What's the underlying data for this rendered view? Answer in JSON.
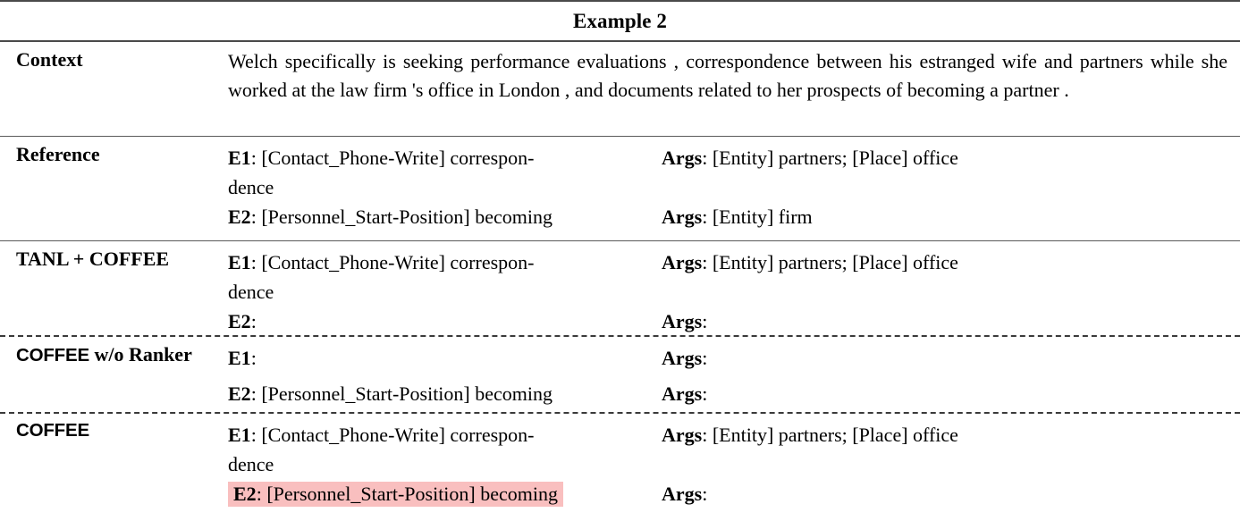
{
  "title": "Example 2",
  "highlight_color": "#f9bfbf",
  "rule_color": "#4a4a4a",
  "labels": {
    "context": "Context",
    "reference": "Reference",
    "tanl_coffee": "TANL + COFFEE",
    "coffee_wo_ranker_sans": "COFFEE",
    "coffee_wo_ranker_serif": " w/o Ranker",
    "coffee": "COFFEE"
  },
  "context": {
    "text": "Welch specifically is seeking performance evaluations , correspondence between his estranged wife and partners while she worked at the law firm 's office in London , and documents related to her prospects of becoming a partner ."
  },
  "tags": {
    "e1": "E1",
    "e2": "E2",
    "args": "Args",
    "colon": ":"
  },
  "rows": [
    {
      "label": "Reference",
      "entries": [
        {
          "event_tag": "E1",
          "event_value": "[Contact_Phone-Write] correspondence",
          "args_tag": "Args",
          "args_value": "[Entity] partners; [Place] office",
          "highlighted": false,
          "wraps": true
        },
        {
          "event_tag": "E2",
          "event_value": "[Personnel_Start-Position] becoming",
          "args_tag": "Args",
          "args_value": "[Entity] firm",
          "highlighted": false,
          "wraps": false
        }
      ]
    },
    {
      "label": "TANL + COFFEE",
      "entries": [
        {
          "event_tag": "E1",
          "event_value": "[Contact_Phone-Write] correspondence",
          "args_tag": "Args",
          "args_value": "[Entity] partners; [Place] office",
          "highlighted": false,
          "wraps": true
        },
        {
          "event_tag": "E2",
          "event_value": "",
          "args_tag": "Args",
          "args_value": "",
          "highlighted": false,
          "wraps": false
        }
      ]
    },
    {
      "label": "COFFEE w/o Ranker",
      "entries": [
        {
          "event_tag": "E1",
          "event_value": "",
          "args_tag": "Args",
          "args_value": "",
          "highlighted": false,
          "wraps": false
        },
        {
          "event_tag": "E2",
          "event_value": "[Personnel_Start-Position] becoming",
          "args_tag": "Args",
          "args_value": "",
          "highlighted": false,
          "wraps": false
        }
      ]
    },
    {
      "label": "COFFEE",
      "entries": [
        {
          "event_tag": "E1",
          "event_value": "[Contact_Phone-Write] correspondence",
          "args_tag": "Args",
          "args_value": "[Entity] partners; [Place] office",
          "highlighted": false,
          "wraps": true
        },
        {
          "event_tag": "E2",
          "event_value": "[Personnel_Start-Position] becoming",
          "args_tag": "Args",
          "args_value": "",
          "highlighted": true,
          "wraps": false
        }
      ]
    }
  ],
  "cells": {
    "e1_long_part1": "[Contact_Phone-Write]",
    "e1_long_part2": "correspon-",
    "e1_long_part3": "dence",
    "e2_personnel": "[Personnel_Start-Position] becoming",
    "args_partners_office": "[Entity] partners; [Place] office",
    "args_firm": "[Entity] firm",
    "args_empty": ""
  }
}
